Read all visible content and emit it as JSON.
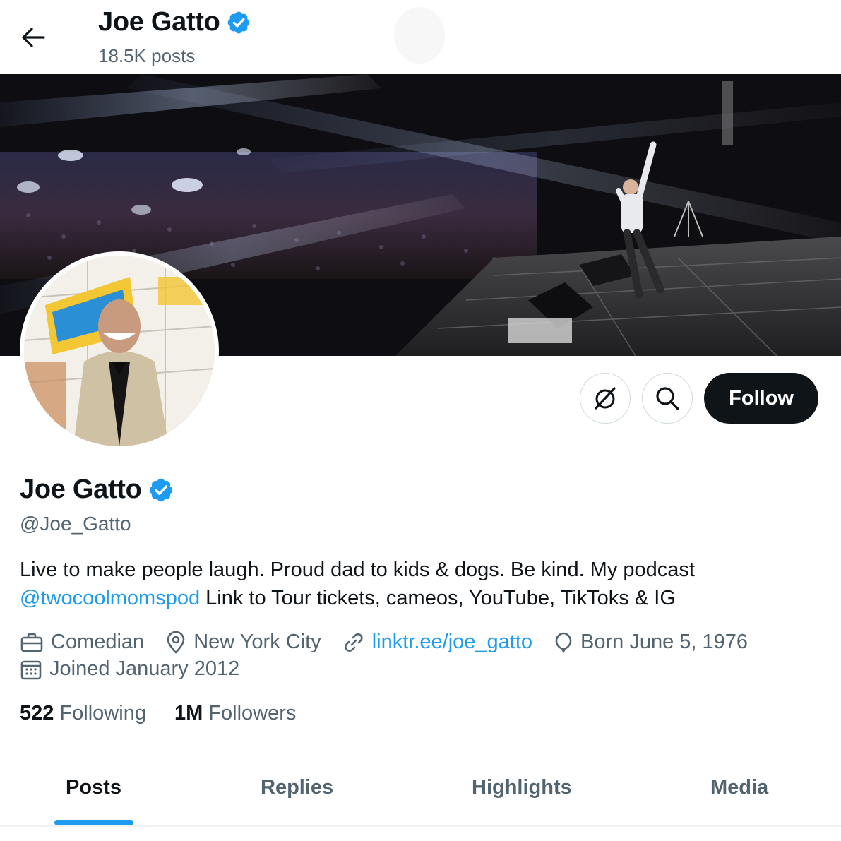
{
  "header": {
    "title": "Joe Gatto",
    "posts_count": "18.5K posts"
  },
  "actions": {
    "follow_label": "Follow"
  },
  "profile": {
    "display_name": "Joe Gatto",
    "handle": "@Joe_Gatto",
    "bio_text_1": "Live to make people laugh. Proud dad to kids & dogs.  Be kind. My podcast ",
    "bio_mention": "@twocoolmomspod",
    "bio_text_2": " Link to Tour tickets, cameos, YouTube, TikToks & IG",
    "profession": "Comedian",
    "location": "New York City",
    "website": "linktr.ee/joe_gatto",
    "birthday": "Born June 5, 1976",
    "joined": "Joined January 2012"
  },
  "stats": {
    "following_count": "522",
    "following_label": "Following",
    "followers_count": "1M",
    "followers_label": "Followers"
  },
  "tabs": [
    {
      "label": "Posts",
      "active": true
    },
    {
      "label": "Replies",
      "active": false
    },
    {
      "label": "Highlights",
      "active": false
    },
    {
      "label": "Media",
      "active": false
    }
  ],
  "colors": {
    "accent": "#1d9bf0",
    "text_primary": "#0f1419",
    "text_secondary": "#536471",
    "verified_badge": "#1d9bf0"
  },
  "icons": {
    "back": "arrow-left-icon",
    "verified": "verified-badge-icon",
    "grok": "grok-icon",
    "search": "search-icon",
    "profession": "briefcase-icon",
    "location": "location-pin-icon",
    "website": "link-icon",
    "birthday": "balloon-icon",
    "joined": "calendar-icon"
  }
}
